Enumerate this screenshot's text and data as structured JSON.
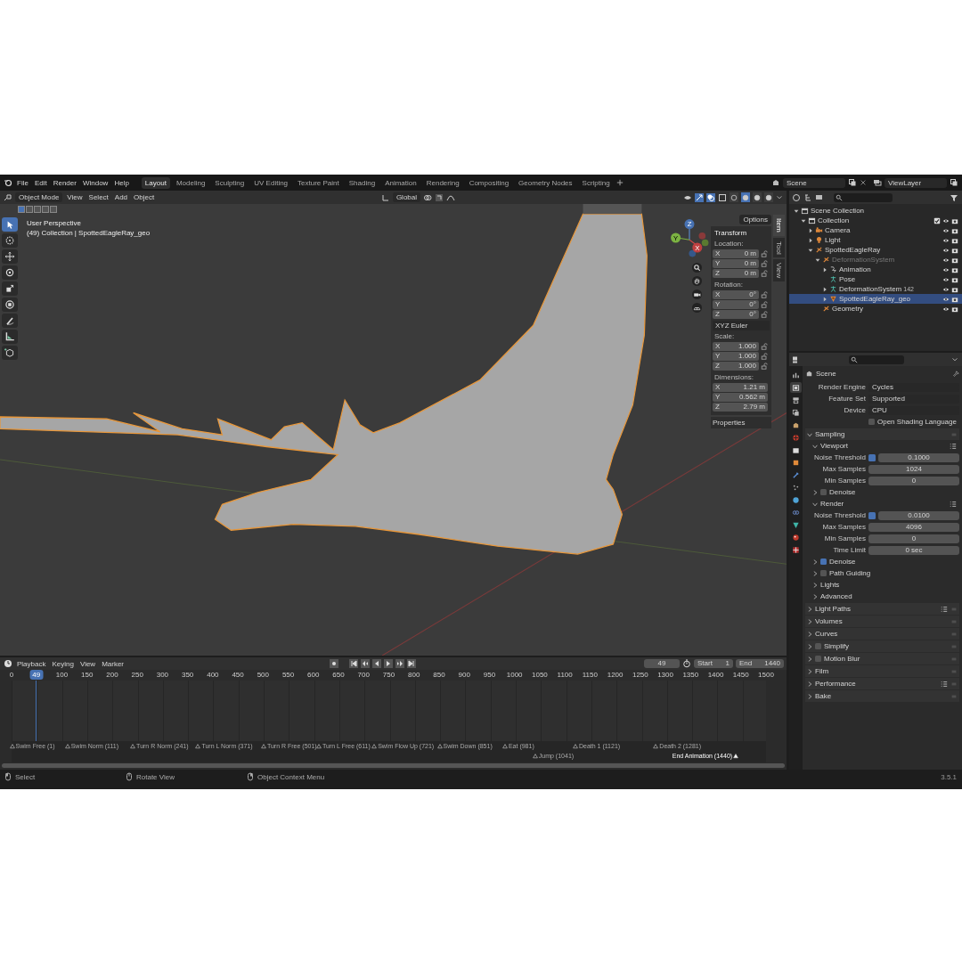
{
  "menu": [
    "File",
    "Edit",
    "Render",
    "Window",
    "Help"
  ],
  "workspaces": [
    {
      "label": "Layout",
      "selected": true
    },
    {
      "label": "Modeling",
      "selected": false
    },
    {
      "label": "Sculpting",
      "selected": false
    },
    {
      "label": "UV Editing",
      "selected": false
    },
    {
      "label": "Texture Paint",
      "selected": false
    },
    {
      "label": "Shading",
      "selected": false
    },
    {
      "label": "Animation",
      "selected": false
    },
    {
      "label": "Rendering",
      "selected": false
    },
    {
      "label": "Compositing",
      "selected": false
    },
    {
      "label": "Geometry Nodes",
      "selected": false
    },
    {
      "label": "Scripting",
      "selected": false
    }
  ],
  "scene": "Scene",
  "view_layer": "ViewLayer",
  "viewport": {
    "mode": "Object Mode",
    "menus": [
      "View",
      "Select",
      "Add",
      "Object"
    ],
    "orientation": "Global",
    "select_modes": [
      {
        "selected": true
      },
      {
        "selected": false
      },
      {
        "selected": false
      },
      {
        "selected": false
      },
      {
        "selected": false
      }
    ],
    "shading": [
      {
        "kind": "wireframe",
        "selected": false
      },
      {
        "kind": "solid",
        "selected": true
      },
      {
        "kind": "material",
        "selected": false
      },
      {
        "kind": "rendered",
        "selected": false
      }
    ],
    "options": "Options",
    "overlay_text": [
      "User Perspective",
      "(49) Collection | SpottedEagleRay_geo"
    ],
    "gizmo": [
      "Z",
      "Y",
      "X"
    ],
    "tools": [
      {
        "kind": "select",
        "selected": true
      },
      {
        "kind": "cursor",
        "selected": false
      },
      {
        "kind": "move",
        "selected": false
      },
      {
        "kind": "rotate",
        "selected": false
      },
      {
        "kind": "scale",
        "selected": false
      },
      {
        "kind": "transform",
        "selected": false
      },
      {
        "kind": "annotate",
        "selected": false
      },
      {
        "kind": "measure",
        "selected": false
      },
      {
        "kind": "add-cube",
        "selected": false
      }
    ]
  },
  "sidebar": {
    "tabs": [
      {
        "label": "Item",
        "selected": true
      },
      {
        "label": "Tool",
        "selected": false
      },
      {
        "label": "View",
        "selected": false
      }
    ],
    "panel": "Transform",
    "groups": [
      {
        "label": "Location:",
        "locks": true,
        "fields": [
          {
            "axis": "X",
            "value": "0 m"
          },
          {
            "axis": "Y",
            "value": "0 m"
          },
          {
            "axis": "Z",
            "value": "0 m"
          }
        ]
      },
      {
        "label": "Rotation:",
        "locks": true,
        "fields": [
          {
            "axis": "X",
            "value": "0°"
          },
          {
            "axis": "Y",
            "value": "0°"
          },
          {
            "axis": "Z",
            "value": "0°"
          }
        ],
        "mode": "XYZ Euler"
      },
      {
        "label": "Scale:",
        "locks": true,
        "fields": [
          {
            "axis": "X",
            "value": "1.000"
          },
          {
            "axis": "Y",
            "value": "1.000"
          },
          {
            "axis": "Z",
            "value": "1.000"
          }
        ]
      },
      {
        "label": "Dimensions:",
        "locks": false,
        "fields": [
          {
            "axis": "X",
            "value": "1.21 m"
          },
          {
            "axis": "Y",
            "value": "0.562 m"
          },
          {
            "axis": "Z",
            "value": "2.79 m"
          }
        ]
      }
    ],
    "more": "Properties"
  },
  "outliner": {
    "items": [
      {
        "label": "Scene Collection",
        "kind": "scene-collection",
        "selected": false,
        "disabled": false,
        "expanded": true,
        "children": [
          {
            "label": "Collection",
            "kind": "collection",
            "selected": false,
            "disabled": false,
            "checked": true,
            "expanded": true,
            "children": [
              {
                "label": "Camera",
                "kind": "camera",
                "selected": false,
                "disabled": false,
                "expanded": false
              },
              {
                "label": "Light",
                "kind": "light",
                "selected": false,
                "disabled": false,
                "expanded": false
              },
              {
                "label": "SpottedEagleRay",
                "kind": "armature",
                "selected": false,
                "disabled": false,
                "expanded": true,
                "children": [
                  {
                    "label": "DeformationSystem",
                    "kind": "armature",
                    "selected": false,
                    "disabled": true,
                    "expanded": true,
                    "children": [
                      {
                        "label": "Animation",
                        "kind": "action",
                        "selected": false,
                        "disabled": false,
                        "expanded": false
                      },
                      {
                        "label": "Pose",
                        "kind": "pose",
                        "selected": false,
                        "disabled": false
                      },
                      {
                        "label": "DeformationSystem",
                        "kind": "armature-data",
                        "selected": false,
                        "disabled": false,
                        "expanded": false,
                        "badge": "142"
                      },
                      {
                        "label": "SpottedEagleRay_geo",
                        "kind": "mesh",
                        "selected": true,
                        "disabled": false,
                        "expanded": false
                      }
                    ]
                  },
                  {
                    "label": "Geometry",
                    "kind": "armature",
                    "selected": false,
                    "disabled": false
                  }
                ]
              }
            ]
          }
        ]
      }
    ]
  },
  "properties": {
    "context": "Scene",
    "settings": [
      {
        "label": "Render Engine",
        "value": "Cycles"
      },
      {
        "label": "Feature Set",
        "value": "Supported"
      },
      {
        "label": "Device",
        "value": "CPU"
      }
    ],
    "osl": {
      "label": "Open Shading Language",
      "checked": false
    },
    "tabs": [
      {
        "kind": "tool",
        "selected": false
      },
      {
        "kind": "render",
        "selected": true
      },
      {
        "kind": "output",
        "selected": false
      },
      {
        "kind": "view-layer",
        "selected": false
      },
      {
        "kind": "scene",
        "selected": false
      },
      {
        "kind": "world",
        "selected": false
      },
      {
        "kind": "collection",
        "selected": false
      },
      {
        "kind": "object",
        "selected": false
      },
      {
        "kind": "modifier",
        "selected": false
      },
      {
        "kind": "particles",
        "selected": false
      },
      {
        "kind": "physics",
        "selected": false
      },
      {
        "kind": "constraint",
        "selected": false
      },
      {
        "kind": "data",
        "selected": false
      },
      {
        "kind": "material",
        "selected": false
      },
      {
        "kind": "texture",
        "selected": false
      }
    ],
    "panels": [
      {
        "title": "Sampling",
        "expanded": true,
        "presets": false,
        "subpanels": [
          {
            "title": "Viewport",
            "expanded": true,
            "presets": true,
            "fields": [
              {
                "label": "Noise Threshold",
                "value": "0.1000",
                "checked": true
              },
              {
                "label": "Max Samples",
                "value": "1024"
              },
              {
                "label": "Min Samples",
                "value": "0"
              }
            ]
          },
          {
            "title": "Denoise",
            "expanded": false,
            "presets": false,
            "checked": false
          },
          {
            "title": "Render",
            "expanded": true,
            "presets": true,
            "fields": [
              {
                "label": "Noise Threshold",
                "value": "0.0100",
                "checked": true
              },
              {
                "label": "Max Samples",
                "value": "4096"
              },
              {
                "label": "Min Samples",
                "value": "0"
              },
              {
                "label": "Time Limit",
                "value": "0 sec"
              }
            ]
          },
          {
            "title": "Denoise",
            "expanded": false,
            "presets": false,
            "checked": true
          },
          {
            "title": "Path Guiding",
            "expanded": false,
            "presets": false,
            "checked": false
          },
          {
            "title": "Lights",
            "expanded": false,
            "presets": false
          },
          {
            "title": "Advanced",
            "expanded": false,
            "presets": false
          }
        ]
      },
      {
        "title": "Light Paths",
        "expanded": false,
        "presets": true
      },
      {
        "title": "Volumes",
        "expanded": false,
        "presets": false
      },
      {
        "title": "Curves",
        "expanded": false,
        "presets": false
      },
      {
        "title": "Simplify",
        "expanded": false,
        "presets": false,
        "checked": false
      },
      {
        "title": "Motion Blur",
        "expanded": false,
        "presets": false,
        "checked": false
      },
      {
        "title": "Film",
        "expanded": false,
        "presets": false
      },
      {
        "title": "Performance",
        "expanded": false,
        "presets": true
      },
      {
        "title": "Bake",
        "expanded": false,
        "presets": false
      }
    ]
  },
  "timeline": {
    "menus": [
      "Playback",
      "Keying",
      "View",
      "Marker"
    ],
    "frame_field": "49",
    "start_label": "Start",
    "start": "1",
    "end_label": "End",
    "end": "1440",
    "playhead": {
      "frame": "49",
      "level": 0.0327
    },
    "ticks": [
      "0",
      "100",
      "150",
      "200",
      "250",
      "300",
      "350",
      "400",
      "450",
      "500",
      "550",
      "600",
      "650",
      "700",
      "750",
      "800",
      "850",
      "900",
      "950",
      "1000",
      "1050",
      "1100",
      "1150",
      "1200",
      "1250",
      "1300",
      "1350",
      "1400",
      "1450",
      "1500"
    ],
    "markers": [
      {
        "label": "Swim Free (1)",
        "level": 0.0007,
        "selected": false
      },
      {
        "label": "Swim Norm (111)",
        "level": 0.074,
        "selected": false
      },
      {
        "label": "Turn R Norm (241)",
        "level": 0.1607,
        "selected": false
      },
      {
        "label": "Turn L Norm (371)",
        "level": 0.2473,
        "selected": false
      },
      {
        "label": "Turn R Free (501)",
        "level": 0.334,
        "selected": false
      },
      {
        "label": "Turn L Free (611)",
        "level": 0.4073,
        "selected": false
      },
      {
        "label": "Swim Flow Up (721)",
        "level": 0.4807,
        "selected": false
      },
      {
        "label": "Swim Down (851)",
        "level": 0.5673,
        "selected": false
      },
      {
        "label": "Eat (981)",
        "level": 0.654,
        "selected": false
      },
      {
        "label": "Jump (1041)",
        "level": 0.694,
        "selected": false
      },
      {
        "label": "Death 1 (1121)",
        "level": 0.7473,
        "selected": false
      },
      {
        "label": "Death 2 (1281)",
        "level": 0.854,
        "selected": false
      },
      {
        "label": "End Animation (1440)",
        "level": 0.96,
        "selected": true
      }
    ]
  },
  "status": [
    "Select",
    "Rotate View",
    "Object Context Menu"
  ],
  "version": "3.5.1"
}
